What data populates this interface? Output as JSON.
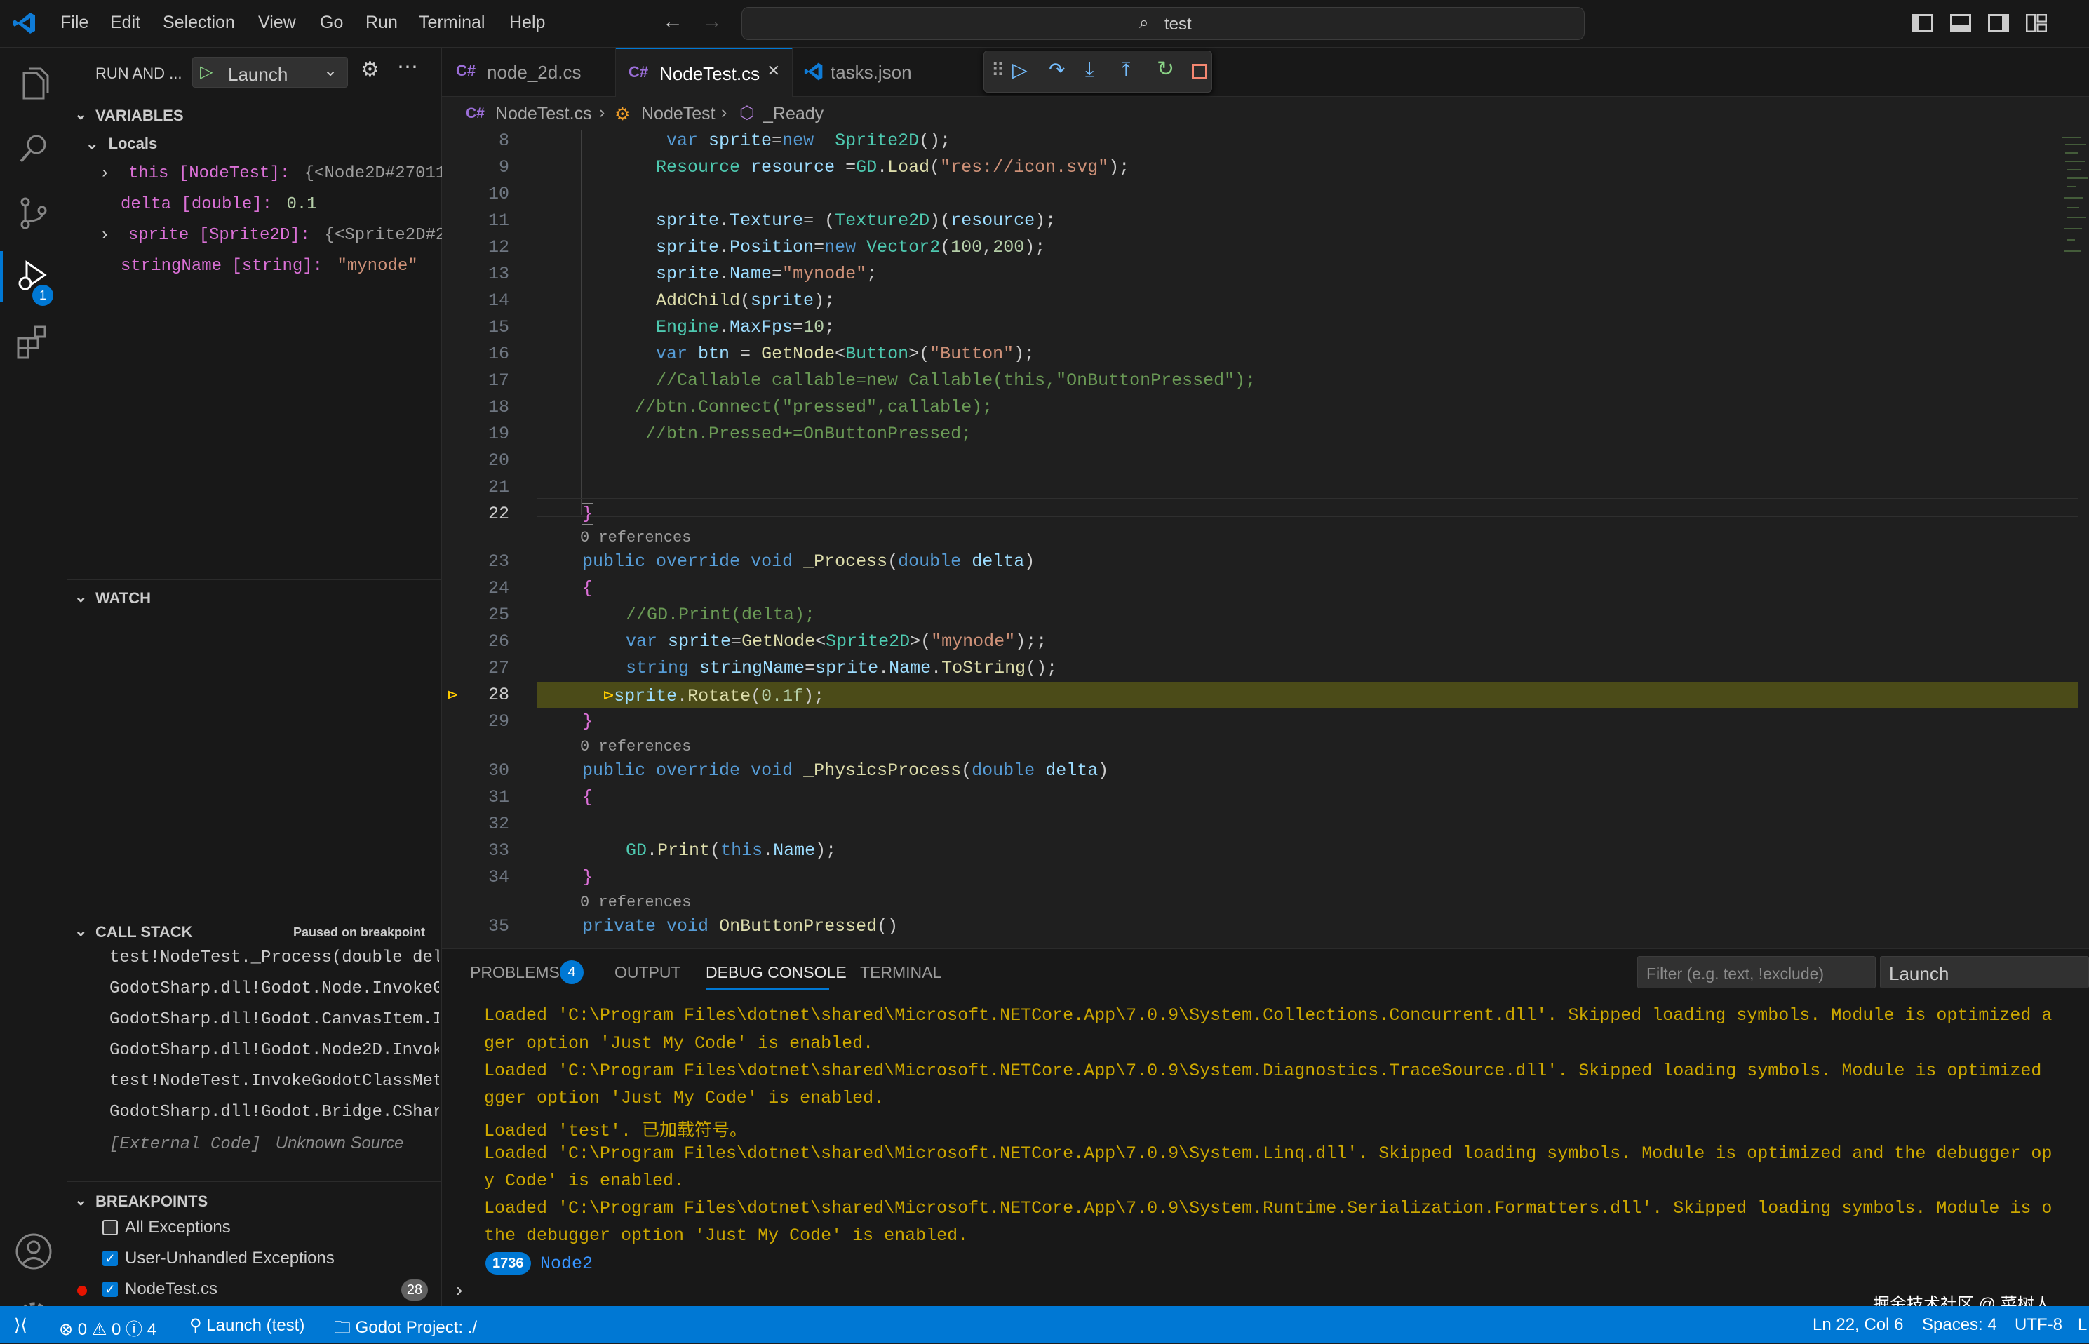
{
  "menu": [
    "File",
    "Edit",
    "Selection",
    "View",
    "Go",
    "Run",
    "Terminal",
    "Help"
  ],
  "search": {
    "value": "test"
  },
  "run": {
    "title": "RUN AND ...",
    "config": "Launch"
  },
  "debug_badge": "1",
  "variables": {
    "header": "VARIABLES",
    "locals": "Locals",
    "items": [
      {
        "name": "this [NodeTest]:",
        "value": "{<Node2D#27011..."
      },
      {
        "name": "delta [double]:",
        "value": "0.1"
      },
      {
        "name": "sprite [Sprite2D]:",
        "value": "{<Sprite2D#2..."
      },
      {
        "name": "stringName [string]:",
        "value": "\"mynode\""
      }
    ]
  },
  "watch": {
    "header": "WATCH"
  },
  "callstack": {
    "header": "CALL STACK",
    "status": "Paused on breakpoint",
    "frames": [
      "test!NodeTest._Process(double del",
      "GodotSharp.dll!Godot.Node.InvokeG",
      "GodotSharp.dll!Godot.CanvasItem.I",
      "GodotSharp.dll!Godot.Node2D.Invok",
      "test!NodeTest.InvokeGodotClassMet",
      "GodotSharp.dll!Godot.Bridge.CShar"
    ],
    "external": "[External Code]",
    "external_source": "Unknown Source"
  },
  "breakpoints": {
    "header": "BREAKPOINTS",
    "items": [
      {
        "label": "All Exceptions",
        "checked": false
      },
      {
        "label": "User-Unhandled Exceptions",
        "checked": true
      },
      {
        "label": "NodeTest.cs",
        "checked": true,
        "count": "28"
      }
    ]
  },
  "tabs": [
    {
      "icon": "C#",
      "label": "node_2d.cs"
    },
    {
      "icon": "C#",
      "label": "NodeTest.cs"
    },
    {
      "icon": "vscode-icon",
      "label": "tasks.json"
    }
  ],
  "breadcrumb": {
    "file": "NodeTest.cs",
    "cls": "NodeTest",
    "method": "_Ready"
  },
  "code_refs": "0 references",
  "panel": {
    "tabs": [
      "PROBLEMS",
      "OUTPUT",
      "DEBUG CONSOLE",
      "TERMINAL"
    ],
    "problems_count": "4",
    "filter_placeholder": "Filter (e.g. text, !exclude)",
    "launch": "Launch",
    "console": [
      "Loaded 'C:\\Program Files\\dotnet\\shared\\Microsoft.NETCore.App\\7.0.9\\System.Collections.Concurrent.dll'. Skipped loading symbols. Module is optimized a",
      "ger option 'Just My Code' is enabled.",
      "Loaded 'C:\\Program Files\\dotnet\\shared\\Microsoft.NETCore.App\\7.0.9\\System.Diagnostics.TraceSource.dll'. Skipped loading symbols. Module is optimized",
      "gger option 'Just My Code' is enabled.",
      "Loaded 'test'. 已加载符号。",
      "Loaded 'C:\\Program Files\\dotnet\\shared\\Microsoft.NETCore.App\\7.0.9\\System.Linq.dll'. Skipped loading symbols. Module is optimized and the debugger op",
      "y Code' is enabled.",
      "Loaded 'C:\\Program Files\\dotnet\\shared\\Microsoft.NETCore.App\\7.0.9\\System.Runtime.Serialization.Formatters.dll'. Skipped loading symbols. Module is o",
      "the debugger option 'Just My Code' is enabled."
    ],
    "count_badge": "1736",
    "count_text": "Node2"
  },
  "status": {
    "errors": "0",
    "warnings": "0",
    "info": "4",
    "launch": "Launch (test)",
    "project": "Godot Project: ./",
    "position": "Ln 22, Col 6",
    "spaces": "Spaces: 4",
    "encoding": "UTF-8",
    "eol": "L",
    "watermark": "掘金技术社区 @ 菜树人"
  }
}
